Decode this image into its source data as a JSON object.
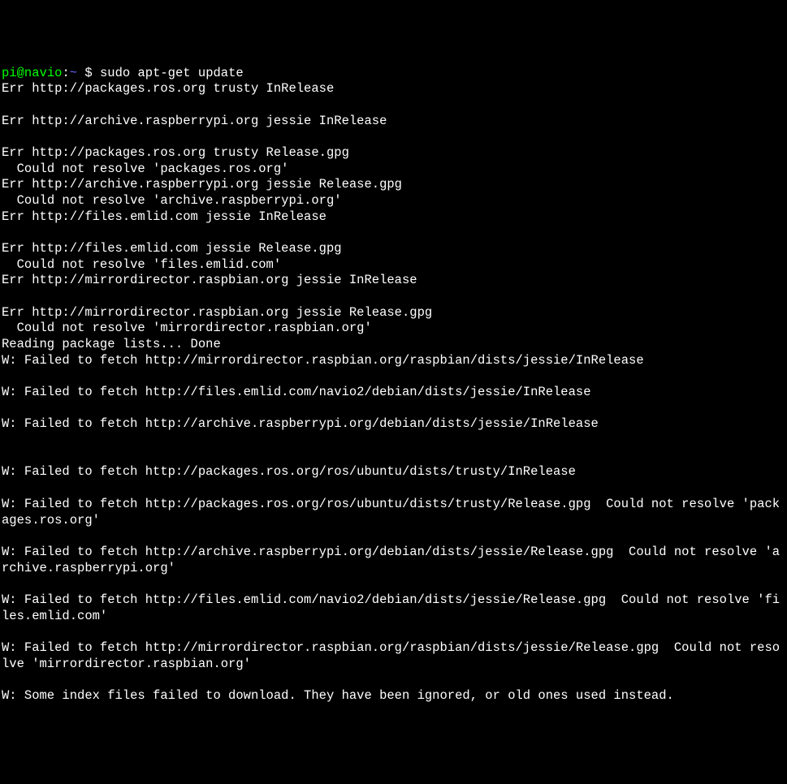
{
  "prompt": {
    "user": "pi",
    "at": "@",
    "host": "navio",
    "colon": ":",
    "path": "~",
    "dollar": " $ ",
    "command": "sudo apt-get update"
  },
  "lines": [
    "Err http://packages.ros.org trusty InRelease",
    "",
    "Err http://archive.raspberrypi.org jessie InRelease",
    "",
    "Err http://packages.ros.org trusty Release.gpg",
    "  Could not resolve 'packages.ros.org'",
    "Err http://archive.raspberrypi.org jessie Release.gpg",
    "  Could not resolve 'archive.raspberrypi.org'",
    "Err http://files.emlid.com jessie InRelease",
    "",
    "Err http://files.emlid.com jessie Release.gpg",
    "  Could not resolve 'files.emlid.com'",
    "Err http://mirrordirector.raspbian.org jessie InRelease",
    "",
    "Err http://mirrordirector.raspbian.org jessie Release.gpg",
    "  Could not resolve 'mirrordirector.raspbian.org'",
    "Reading package lists... Done",
    "W: Failed to fetch http://mirrordirector.raspbian.org/raspbian/dists/jessie/InRelease",
    "",
    "W: Failed to fetch http://files.emlid.com/navio2/debian/dists/jessie/InRelease",
    "",
    "W: Failed to fetch http://archive.raspberrypi.org/debian/dists/jessie/InRelease",
    "",
    "",
    "W: Failed to fetch http://packages.ros.org/ros/ubuntu/dists/trusty/InRelease",
    "",
    "W: Failed to fetch http://packages.ros.org/ros/ubuntu/dists/trusty/Release.gpg  Could not resolve 'packages.ros.org'",
    "",
    "W: Failed to fetch http://archive.raspberrypi.org/debian/dists/jessie/Release.gpg  Could not resolve 'archive.raspberrypi.org'",
    "",
    "W: Failed to fetch http://files.emlid.com/navio2/debian/dists/jessie/Release.gpg  Could not resolve 'files.emlid.com'",
    "",
    "W: Failed to fetch http://mirrordirector.raspbian.org/raspbian/dists/jessie/Release.gpg  Could not resolve 'mirrordirector.raspbian.org'",
    "",
    "W: Some index files failed to download. They have been ignored, or old ones used instead."
  ]
}
